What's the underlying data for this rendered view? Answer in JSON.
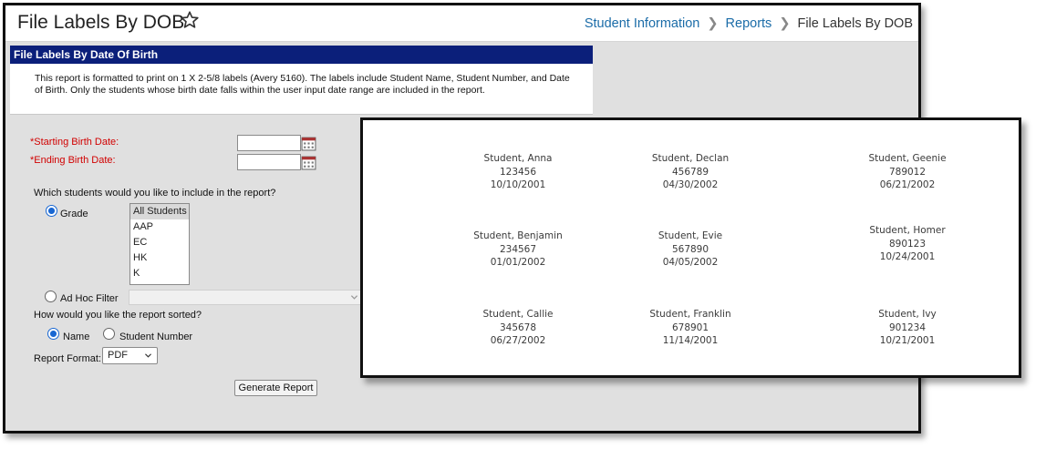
{
  "header": {
    "title": "File Labels By DOB",
    "breadcrumb": [
      "Student Information",
      "Reports",
      "File Labels By DOB"
    ]
  },
  "info": {
    "heading": "File Labels By Date Of Birth",
    "text": "This report is formatted to print on 1 X 2-5/8 labels (Avery 5160). The labels include Student Name, Student Number, and Date of Birth. Only the students whose birth date falls within the user input date range are included in the report."
  },
  "form": {
    "starting_birth_date": {
      "required_mark": "*",
      "label": "Starting Birth Date:",
      "value": ""
    },
    "ending_birth_date": {
      "required_mark": "*",
      "label": "Ending Birth Date:",
      "value": ""
    },
    "include_question": "Which students would you like to include in the report?",
    "grade_radio_label": "Grade",
    "grade_options": [
      "All Students",
      "AAP",
      "EC",
      "HK",
      "K"
    ],
    "grade_selected": "All Students",
    "adhoc_radio_label": "Ad Hoc Filter",
    "sort_question": "How would you like the report sorted?",
    "sort_name_label": "Name",
    "sort_number_label": "Student Number",
    "report_format_label": "Report Format:",
    "report_format_value": "PDF",
    "generate_label": "Generate Report"
  },
  "labels": [
    {
      "name": "Student, Anna",
      "number": "123456",
      "dob": "10/10/2001"
    },
    {
      "name": "Student, Declan",
      "number": "456789",
      "dob": "04/30/2002"
    },
    {
      "name": "Student, Geenie",
      "number": "789012",
      "dob": "06/21/2002"
    },
    {
      "name": "Student, Benjamin",
      "number": "234567",
      "dob": "01/01/2002"
    },
    {
      "name": "Student, Evie",
      "number": "567890",
      "dob": "04/05/2002"
    },
    {
      "name": "Student, Homer",
      "number": "890123",
      "dob": "10/24/2001"
    },
    {
      "name": "Student, Callie",
      "number": "345678",
      "dob": "06/27/2002"
    },
    {
      "name": "Student, Franklin",
      "number": "678901",
      "dob": "11/14/2001"
    },
    {
      "name": "Student, Ivy",
      "number": "901234",
      "dob": "10/21/2001"
    }
  ],
  "colors": {
    "heading_bg": "#0b1f7a",
    "link": "#1b6ca8",
    "required": "#d10000",
    "radio_accent": "#1967d2"
  }
}
